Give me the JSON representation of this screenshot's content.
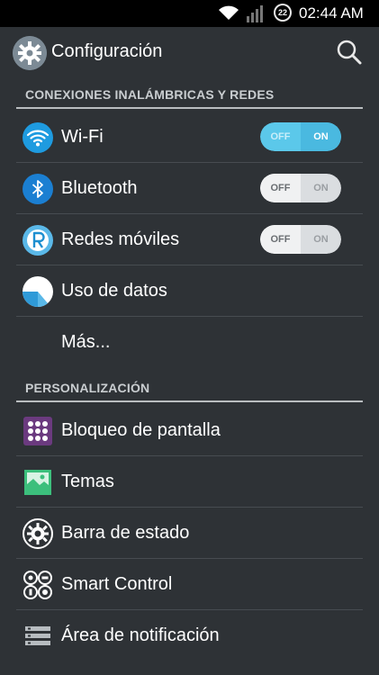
{
  "status_bar": {
    "notification_count": "22",
    "time": "02:44 AM"
  },
  "action_bar": {
    "title": "Configuración"
  },
  "sections": [
    {
      "header": "CONEXIONES INALÁMBRICAS Y REDES",
      "items": [
        {
          "label": "Wi-Fi",
          "toggle": {
            "off": "OFF",
            "on": "ON",
            "state": "on"
          }
        },
        {
          "label": "Bluetooth",
          "toggle": {
            "off": "OFF",
            "on": "ON",
            "state": "off"
          }
        },
        {
          "label": "Redes móviles",
          "toggle": {
            "off": "OFF",
            "on": "ON",
            "state": "off"
          }
        },
        {
          "label": "Uso de datos"
        },
        {
          "label": "Más..."
        }
      ]
    },
    {
      "header": "PERSONALIZACIÓN",
      "items": [
        {
          "label": "Bloqueo de pantalla"
        },
        {
          "label": "Temas"
        },
        {
          "label": "Barra de estado"
        },
        {
          "label": "Smart Control"
        },
        {
          "label": "Área de notificación"
        }
      ]
    }
  ],
  "colors": {
    "background": "#2e3236",
    "accent": "#5bc8ea",
    "wifi_icon": "#1e9be0",
    "bluetooth_icon": "#1b7fd2",
    "lock_icon": "#6b3a7f",
    "themes_icon": "#3cbf7c"
  },
  "icons": {
    "app": "gear-icon",
    "search": "search-icon",
    "wifi": "wifi-icon",
    "bluetooth": "bluetooth-icon",
    "mobile_networks": "mobile-networks-icon",
    "data_usage": "data-usage-icon",
    "lock_screen": "lock-pattern-icon",
    "themes": "themes-icon",
    "status_bar": "gear-ring-icon",
    "smart_control": "smart-control-icon",
    "notification_area": "notification-panel-icon"
  }
}
